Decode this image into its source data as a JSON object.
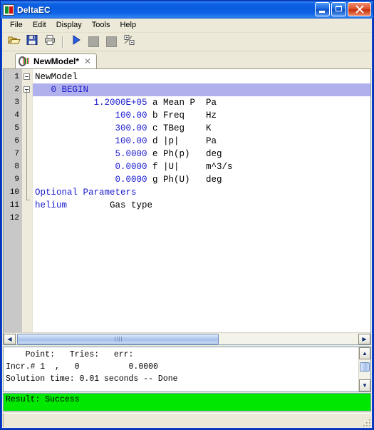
{
  "window": {
    "title": "DeltaEC",
    "app_icon": "deltaec-logo-icon",
    "buttons": {
      "minimize": "minimize-button",
      "maximize": "maximize-button",
      "close": "close-button"
    }
  },
  "menubar": {
    "items": [
      {
        "label": "File"
      },
      {
        "label": "Edit"
      },
      {
        "label": "Display"
      },
      {
        "label": "Tools"
      },
      {
        "label": "Help"
      }
    ]
  },
  "toolbar": {
    "buttons": [
      {
        "name": "open-file-icon",
        "type": "icon"
      },
      {
        "name": "save-file-icon",
        "type": "icon"
      },
      {
        "name": "print-icon",
        "type": "icon"
      },
      {
        "name": "separator",
        "type": "sep"
      },
      {
        "name": "run-icon",
        "type": "icon"
      },
      {
        "name": "disabled-square-1-icon",
        "type": "square"
      },
      {
        "name": "disabled-square-2-icon",
        "type": "square"
      },
      {
        "name": "plus-minus-icon",
        "type": "icon"
      }
    ]
  },
  "tab": {
    "label": "NewModel*",
    "close_glyph": "✕",
    "icon": "deltaec-model-icon"
  },
  "editor": {
    "line_numbers": [
      "1",
      "2",
      "3",
      "4",
      "5",
      "6",
      "7",
      "8",
      "9",
      "10",
      "11",
      "12"
    ],
    "lines": [
      {
        "n": 1,
        "segments": [
          {
            "text": "NewModel",
            "color": "black"
          }
        ],
        "selected": false
      },
      {
        "n": 2,
        "segments": [
          {
            "text": "   0 BEGIN",
            "color": "blue"
          }
        ],
        "selected": true
      },
      {
        "n": 3,
        "segments": [
          {
            "text": "           1.2000E+05 ",
            "color": "blue"
          },
          {
            "text": "a Mean P  Pa",
            "color": "black"
          }
        ],
        "selected": false
      },
      {
        "n": 4,
        "segments": [
          {
            "text": "               100.00 ",
            "color": "blue"
          },
          {
            "text": "b Freq    Hz",
            "color": "black"
          }
        ],
        "selected": false
      },
      {
        "n": 5,
        "segments": [
          {
            "text": "               300.00 ",
            "color": "blue"
          },
          {
            "text": "c TBeg    K",
            "color": "black"
          }
        ],
        "selected": false
      },
      {
        "n": 6,
        "segments": [
          {
            "text": "               100.00 ",
            "color": "blue"
          },
          {
            "text": "d |p|     Pa",
            "color": "black"
          }
        ],
        "selected": false
      },
      {
        "n": 7,
        "segments": [
          {
            "text": "               5.0000 ",
            "color": "blue"
          },
          {
            "text": "e Ph(p)   deg",
            "color": "black"
          }
        ],
        "selected": false
      },
      {
        "n": 8,
        "segments": [
          {
            "text": "               0.0000 ",
            "color": "blue"
          },
          {
            "text": "f |U|     m^3/s",
            "color": "black"
          }
        ],
        "selected": false
      },
      {
        "n": 9,
        "segments": [
          {
            "text": "               0.0000 ",
            "color": "blue"
          },
          {
            "text": "g Ph(U)   deg",
            "color": "black"
          }
        ],
        "selected": false
      },
      {
        "n": 10,
        "segments": [
          {
            "text": "Optional Parameters",
            "color": "blue"
          }
        ],
        "selected": false
      },
      {
        "n": 11,
        "segments": [
          {
            "text": "helium        ",
            "color": "blue"
          },
          {
            "text": "Gas type",
            "color": "black"
          }
        ],
        "selected": false
      },
      {
        "n": 12,
        "segments": [
          {
            "text": "",
            "color": "black"
          }
        ],
        "selected": false
      }
    ],
    "fold_rows": [
      1,
      2
    ],
    "colors": {
      "keyword": "#1a1ad0",
      "text": "#000000",
      "selection": "#b0b0ec"
    }
  },
  "hscrollbar": {
    "left_arrow": "◀",
    "right_arrow": "▶"
  },
  "output": {
    "lines": [
      "    Point:   Tries:   err:",
      "Incr.# 1  ,   0          0.0000",
      "Solution time: 0.01 seconds -- Done"
    ],
    "scrollbar": {
      "up_arrow": "▲",
      "down_arrow": "▼"
    }
  },
  "result": {
    "text": "Result: Success",
    "background": "#00e800",
    "foreground": "#000000"
  },
  "statusbar": {
    "text": "",
    "resize_grip": "resize-grip-icon"
  }
}
